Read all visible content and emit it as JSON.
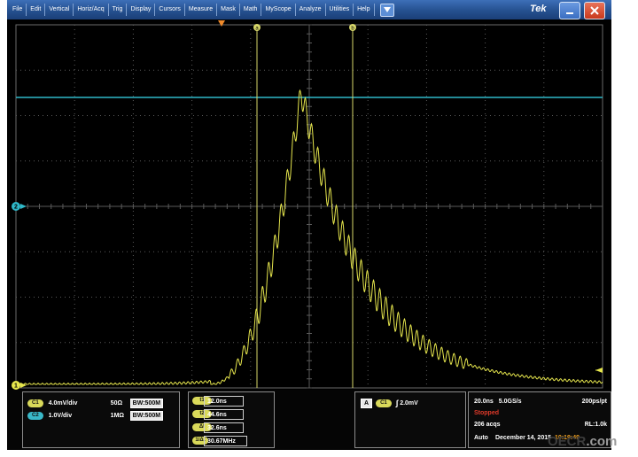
{
  "menu": {
    "items": [
      "File",
      "Edit",
      "Vertical",
      "Horiz/Acq",
      "Trig",
      "Display",
      "Cursors",
      "Measure",
      "Mask",
      "Math",
      "MyScope",
      "Analyze",
      "Utilities",
      "Help"
    ],
    "brand": "Tek"
  },
  "screen": {
    "markers": {
      "cursor_a": "a",
      "cursor_b": "b",
      "ch2": "2",
      "ch1": "1"
    },
    "colors": {
      "ch1": "#e6e64d",
      "ch2": "#2fb8c8",
      "grid": "#5a5a5a"
    }
  },
  "channels": {
    "ch1": {
      "badge": "C1",
      "scale": "4.0mV/div",
      "impedance": "50Ω",
      "bw_prefix": "B",
      "bw": "W:500M"
    },
    "ch2": {
      "badge": "C2",
      "scale": "1.0V/div",
      "impedance": "1MΩ",
      "bw_prefix": "B",
      "bw": "W:500M"
    }
  },
  "cursors": {
    "t1_label": "t1",
    "t1": "12.0ns",
    "t2_label": "t2",
    "t2": "44.6ns",
    "dt_label": "Δt",
    "dt": "32.6ns",
    "f_label": "1/Δt",
    "f": "30.67MHz"
  },
  "trigger": {
    "mode": "A",
    "source": "C1",
    "slope": "∫",
    "level": "2.0mV"
  },
  "acquisition": {
    "timebase": "20.0ns",
    "sample_rate": "5.0GS/s",
    "resolution": "200ps/pt",
    "status": "Stopped",
    "acqs": "206 acqs",
    "record_length": "RL:1.0k",
    "mode": "Auto",
    "date": "December 14, 2015",
    "time": "10:19:49"
  },
  "watermark": {
    "brand": "OECR",
    "suffix": ".com"
  }
}
